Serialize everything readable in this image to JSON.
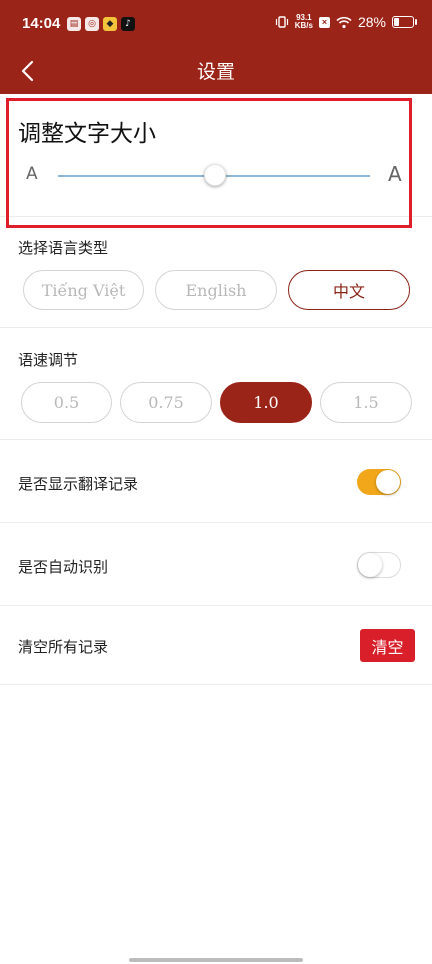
{
  "status_bar": {
    "time": "14:04",
    "notification_icons": [
      "calendar-icon",
      "app-icon",
      "yellow-app-icon",
      "tiktok-icon"
    ],
    "net_speed_value": "93.1",
    "net_speed_unit": "KB/s",
    "sim_badge": "×",
    "battery_percent": "28%",
    "battery_level": 0.28
  },
  "header": {
    "title": "设置",
    "back_icon": "chevron-left-icon"
  },
  "font_size": {
    "title": "调整文字大小",
    "small_label": "A",
    "large_label": "A",
    "level": 0.5
  },
  "language": {
    "label": "选择语言类型",
    "options": [
      "Tiếng Việt",
      "English",
      "中文"
    ],
    "selected": "中文"
  },
  "speech_rate": {
    "label": "语速调节",
    "options": [
      "0.5",
      "0.75",
      "1.0",
      "1.5"
    ],
    "selected": "1.0"
  },
  "settings": {
    "show_history_label": "是否显示翻译记录",
    "show_history_on": true,
    "auto_detect_label": "是否自动识别",
    "auto_detect_on": false,
    "clear_label": "清空所有记录",
    "clear_button": "清空"
  },
  "colors": {
    "brand": "#9b2419",
    "toggle_on": "#f2a71b",
    "clear_button": "#d81f2a",
    "highlight_border": "#e01d2a"
  }
}
